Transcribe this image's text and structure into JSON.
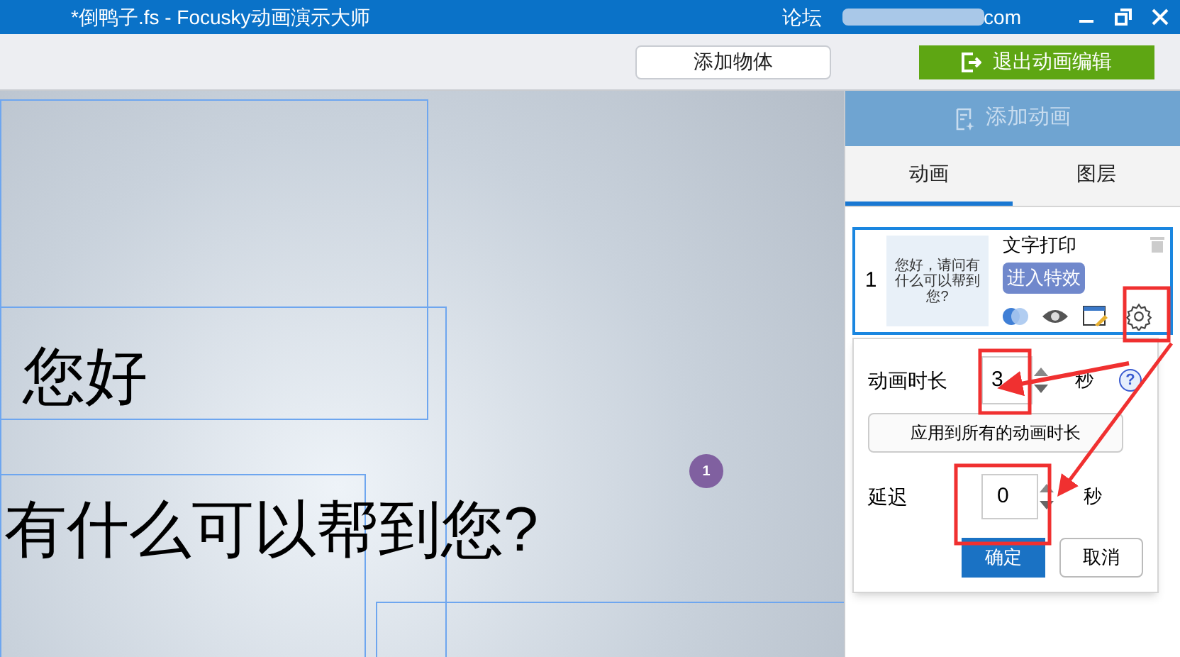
{
  "window": {
    "title": "*倒鸭子.fs - Focusky动画演示大师",
    "forum_link": "论坛",
    "account_tail": "com"
  },
  "toolbar": {
    "buttons": [
      {
        "label": "添加物体",
        "kind": "plain"
      },
      {
        "label": "退出动画编辑",
        "kind": "exit"
      }
    ]
  },
  "canvas": {
    "texts": [
      {
        "text": "您好",
        "kind": "line1"
      },
      {
        "text": "有什么可以帮到您?",
        "kind": "line2"
      }
    ],
    "marker": "1"
  },
  "panel": {
    "add_button": {
      "label": "添加动画",
      "disabled": true
    },
    "tabs": [
      {
        "label": "动画",
        "selected": true
      },
      {
        "label": "图层",
        "selected": false
      }
    ],
    "animations": [
      {
        "index": "1",
        "thumbnail_text": "您好，请问有什么可以帮到您?",
        "name": "文字打印",
        "effect": "进入特效",
        "selected": true
      }
    ],
    "settings": {
      "duration_label": "动画时长",
      "duration_value": "3",
      "duration_unit": "秒",
      "help": "?",
      "apply_all": "应用到所有的动画时长",
      "delay_label": "延迟",
      "delay_value": "0",
      "delay_unit": "秒",
      "ok": "确定",
      "cancel": "取消"
    }
  }
}
